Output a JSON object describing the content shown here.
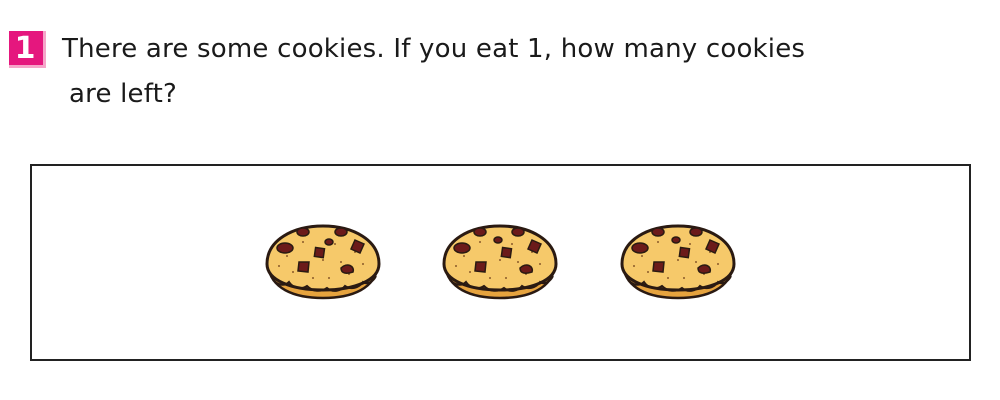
{
  "problem": {
    "number": "1",
    "text_line1": "There are some cookies. If you eat 1, how many cookies",
    "text_line2": "are left?"
  },
  "picture": {
    "items": [
      {
        "name": "cookie-icon"
      },
      {
        "name": "cookie-icon"
      },
      {
        "name": "cookie-icon"
      }
    ]
  },
  "colors": {
    "badge": "#e5177e",
    "badge_shadow": "#f6a5c9",
    "cookie_fill": "#f6c96a",
    "cookie_outline": "#2a1a12",
    "chip": "#6b1a1a"
  }
}
